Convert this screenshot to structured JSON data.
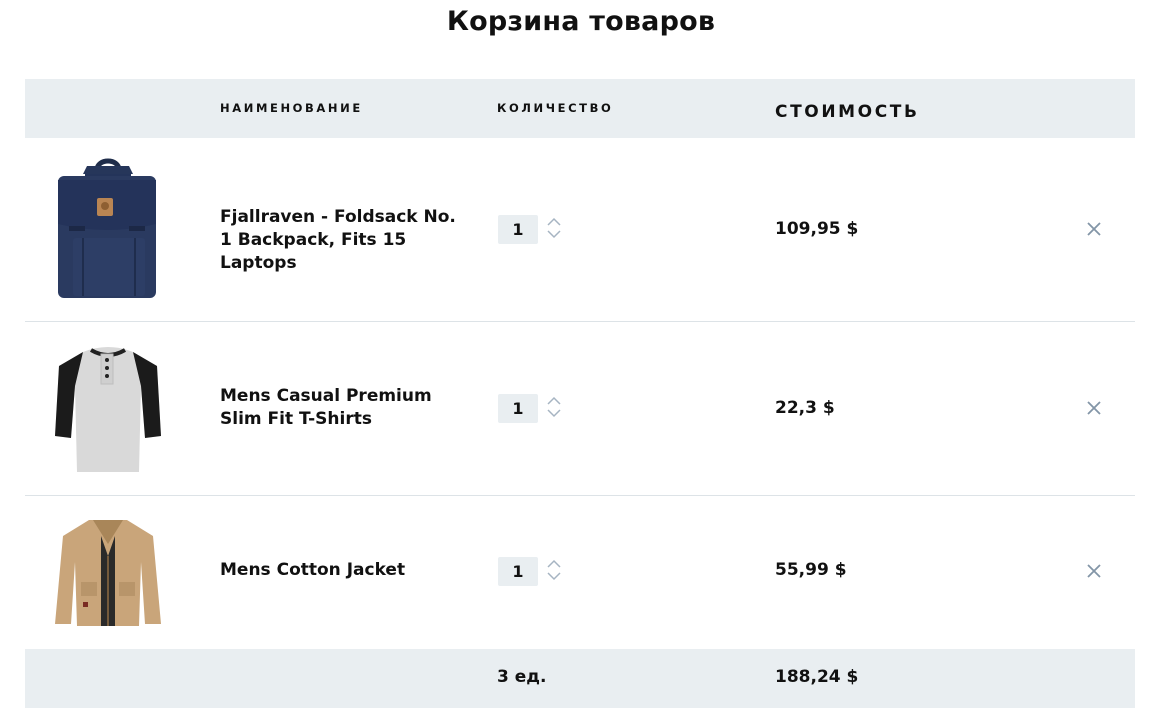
{
  "page": {
    "title": "Корзина товаров"
  },
  "table": {
    "headers": {
      "name": "НАИМЕНОВАНИЕ",
      "quantity": "КОЛИЧЕСТВО",
      "price": "СТОИМОСТЬ"
    },
    "items": [
      {
        "image_icon": "backpack-image",
        "title": "Fjallraven - Foldsack No. 1 Backpack, Fits 15 Laptops",
        "quantity": "1",
        "price": "109,95 $"
      },
      {
        "image_icon": "tshirt-image",
        "title": "Mens Casual Premium Slim Fit T-Shirts",
        "quantity": "1",
        "price": "22,3 $"
      },
      {
        "image_icon": "jacket-image",
        "title": "Mens Cotton Jacket",
        "quantity": "1",
        "price": "55,99 $"
      }
    ],
    "footer": {
      "total_quantity": "3 ед.",
      "total_price": "188,24 $"
    }
  },
  "colors": {
    "header_bg": "#e9eef1",
    "remove_icon": "#8395a7",
    "stepper_icon": "#a6b4c2",
    "divider": "#dde3e7"
  }
}
